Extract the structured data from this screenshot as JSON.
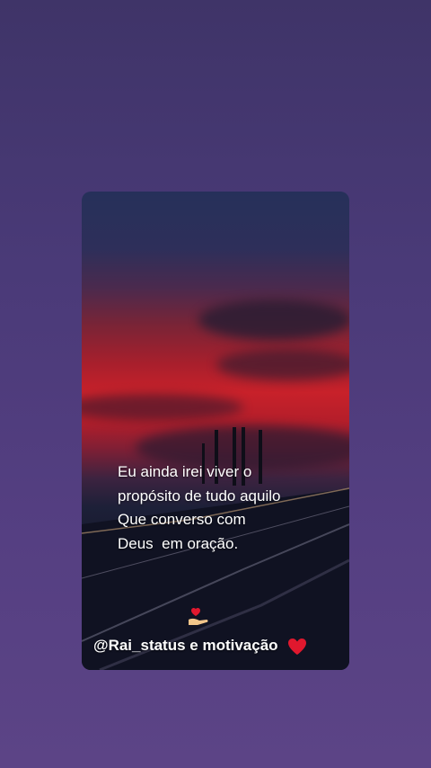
{
  "poem": {
    "line1": "Eu ainda irei viver o",
    "line2": "propósito de tudo aquilo",
    "line3": "Que converso com",
    "line4": "Deus  em oração."
  },
  "footer": {
    "handle": "@Rai_status e motivação"
  },
  "icons": {
    "hand": "hand-with-heart-icon",
    "heart": "red-heart-icon"
  },
  "colors": {
    "heart": "#e0182e",
    "sky_red": "#c8212a",
    "background": "#4a3a78"
  }
}
